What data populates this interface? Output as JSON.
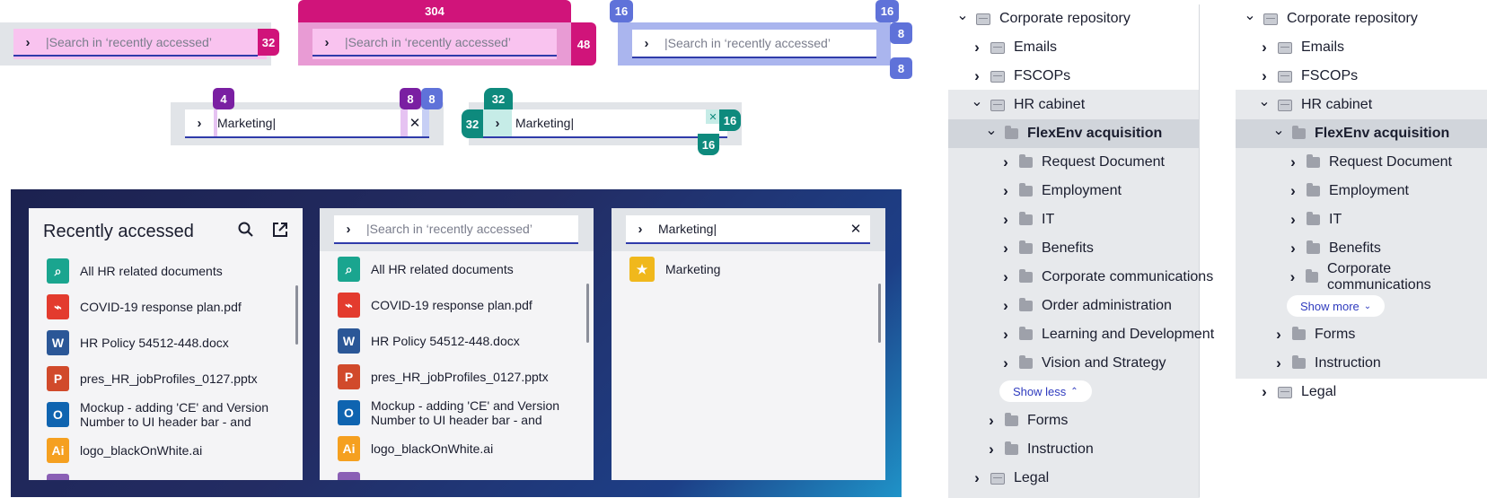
{
  "search_placeholder": "|Search in ‘recently accessed’",
  "search_value": "Marketing|",
  "spec_badges": {
    "a": "32",
    "b_top": "304",
    "b_right": "48",
    "c_tl": "16",
    "c_tr": "16",
    "c_r1": "8",
    "c_r2": "8",
    "d_tl": "4",
    "d_tr1": "8",
    "d_tr2": "8",
    "e_top": "32",
    "e_left": "32",
    "e_right": "16",
    "e_bottom": "16"
  },
  "panel1": {
    "title": "Recently accessed"
  },
  "files": [
    {
      "name": "All HR related documents",
      "icon": "search-icon",
      "color": "#1aa58f",
      "glyph": "⌕"
    },
    {
      "name": "COVID-19 response plan.pdf",
      "icon": "pdf-icon",
      "color": "#e33b2e",
      "glyph": "⌁"
    },
    {
      "name": "HR Policy 54512-448.docx",
      "icon": "word-icon",
      "color": "#2b5797",
      "glyph": "W"
    },
    {
      "name": "pres_HR_jobProfiles_0127.pptx",
      "icon": "powerpoint-icon",
      "color": "#d14a2b",
      "glyph": "P"
    },
    {
      "name": "Mockup - adding 'CE' and Version Number to UI header bar - and other…",
      "icon": "outlook-icon",
      "color": "#0f64b0",
      "glyph": "O"
    },
    {
      "name": "logo_blackOnWhite.ai",
      "icon": "illustrator-icon",
      "color": "#f5a020",
      "glyph": "Ai"
    }
  ],
  "result": {
    "name": "Marketing",
    "icon": "star-icon",
    "color": "#f0b81c"
  },
  "tree": {
    "root": "Corporate repository",
    "emails": "Emails",
    "fscops": "FSCOPs",
    "hr": "HR cabinet",
    "flexenv": "FlexEnv acquisition",
    "children": [
      "Request Document",
      "Employment",
      "IT",
      "Benefits",
      "Corporate communications",
      "Order administration",
      "Learning and Development",
      "Vision and Strategy"
    ],
    "show_less": "Show less",
    "show_more": "Show more",
    "forms": "Forms",
    "instruction": "Instruction",
    "legal": "Legal"
  },
  "colors": {
    "magenta": "#d0147a",
    "blue_spec": "#5f72d9",
    "purple": "#7a1fa2",
    "teal": "#0e8a7d",
    "underline": "#2f3baa",
    "selected_row": "#d1d5db",
    "hover_row": "#e7e9ec"
  }
}
